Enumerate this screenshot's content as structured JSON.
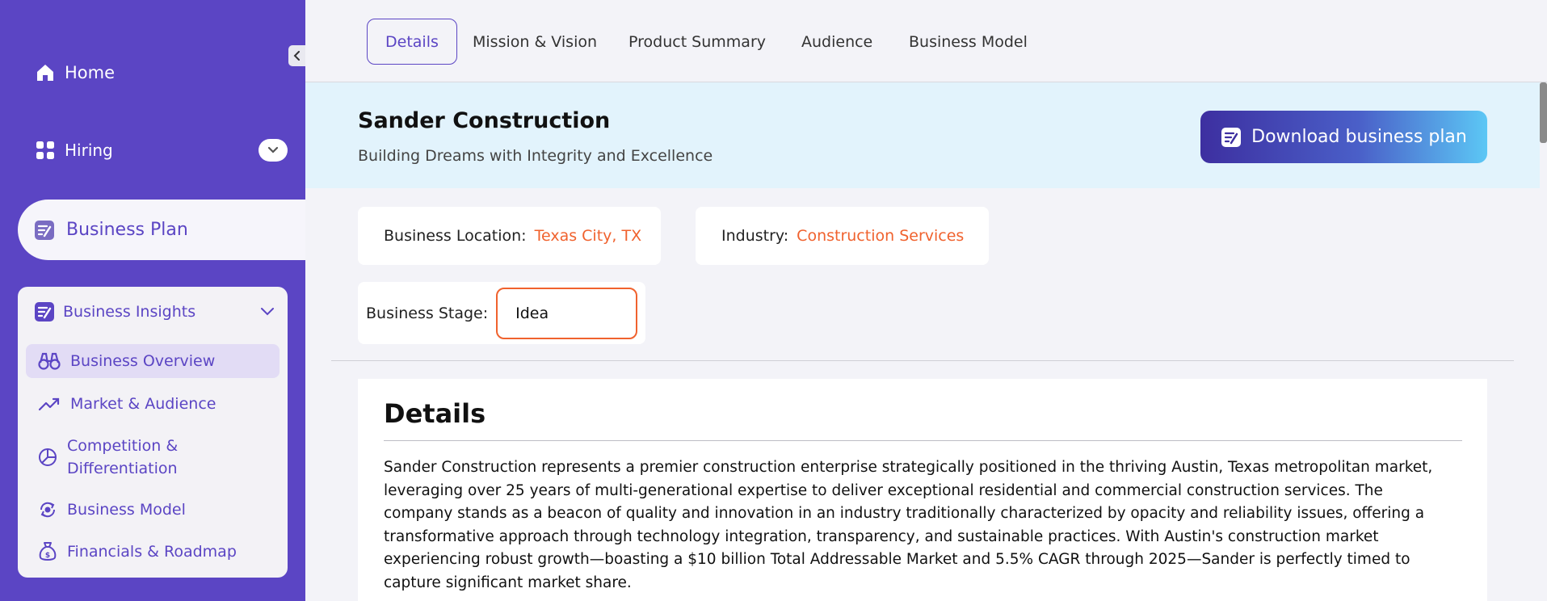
{
  "sidebar": {
    "home_label": "Home",
    "hiring_label": "Hiring",
    "business_plan_label": "Business Plan",
    "insights": {
      "header": "Business Insights",
      "items": [
        {
          "label": "Business Overview",
          "icon": "binoculars-icon"
        },
        {
          "label": "Market & Audience",
          "icon": "trend-up-icon"
        },
        {
          "label_line1": "Competition &",
          "label_line2": "Differentiation",
          "icon": "pie-chart-icon"
        },
        {
          "label": "Business Model",
          "icon": "cycle-icon"
        },
        {
          "label": "Financials & Roadmap",
          "icon": "money-bag-icon"
        }
      ]
    }
  },
  "tabs": [
    "Details",
    "Mission & Vision",
    "Product Summary",
    "Audience",
    "Business Model"
  ],
  "banner": {
    "title": "Sander Construction",
    "subtitle": "Building Dreams with Integrity and Excellence",
    "download_label": "Download business plan"
  },
  "info": {
    "location_label": "Business Location:",
    "location_value": "Texas City, TX",
    "industry_label": "Industry:",
    "industry_value": "Construction Services",
    "stage_label": "Business Stage:",
    "stage_value": "Idea"
  },
  "details": {
    "heading": "Details",
    "line1": "Sander Construction represents a premier construction enterprise strategically positioned in the thriving Austin, Texas metropolitan market,",
    "line2": "leveraging over 25 years of multi-generational expertise to deliver exceptional residential and commercial construction services. The",
    "line3": "company stands as a beacon of quality and innovation in an industry traditionally characterized by opacity and reliability issues, offering a",
    "line4": "transformative approach through technology integration, transparency, and sustainable practices. With Austin's construction market",
    "line5": "experiencing robust growth—boasting a $10 billion Total Addressable Market and 5.5% CAGR through 2025—Sander is perfectly timed to",
    "line6": "capture significant market share."
  },
  "colors": {
    "sidebar_bg": "#5b45c4",
    "accent_orange": "#f0622e",
    "banner_bg": "#e2f3fc"
  }
}
